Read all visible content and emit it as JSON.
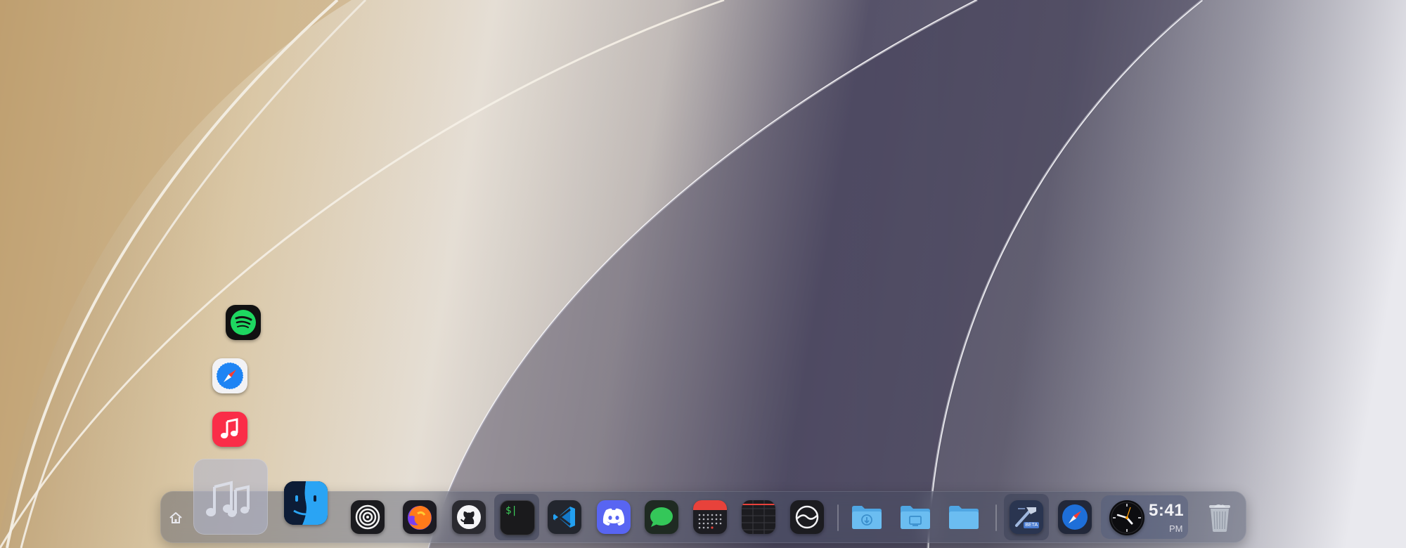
{
  "wallpaper": {
    "description_key": "macos-sequoia-light"
  },
  "clock": {
    "time": "5:41",
    "ampm": "PM"
  },
  "stack_fan": [
    {
      "name": "spotify-icon",
      "color": "#1ed760"
    },
    {
      "name": "safari-icon",
      "color": "#1e84f4"
    },
    {
      "name": "music-icon",
      "color": "#fa2d48"
    }
  ],
  "dock_items": [
    {
      "name": "home-icon"
    },
    {
      "name": "music-stack-icon"
    },
    {
      "name": "finder-icon"
    },
    {
      "name": "spiral-app-icon"
    },
    {
      "name": "firefox-icon"
    },
    {
      "name": "github-desktop-icon"
    },
    {
      "name": "terminal-icon",
      "prompt": "$|"
    },
    {
      "name": "vscode-icon"
    },
    {
      "name": "discord-icon"
    },
    {
      "name": "messages-icon"
    },
    {
      "name": "calendar-icon"
    },
    {
      "name": "notes-grid-icon"
    },
    {
      "name": "iina-icon"
    },
    {
      "name": "downloads-folder-icon"
    },
    {
      "name": "desktop-folder-icon"
    },
    {
      "name": "documents-folder-icon"
    },
    {
      "name": "xcode-beta-icon",
      "badge": "BETA"
    },
    {
      "name": "safari-dock-icon"
    },
    {
      "name": "clock-widget"
    },
    {
      "name": "trash-icon"
    }
  ],
  "colors": {
    "dock_bg": "#464c62",
    "folder_blue": "#5fb4ea",
    "discord": "#5865f2",
    "messages": "#34c759"
  }
}
